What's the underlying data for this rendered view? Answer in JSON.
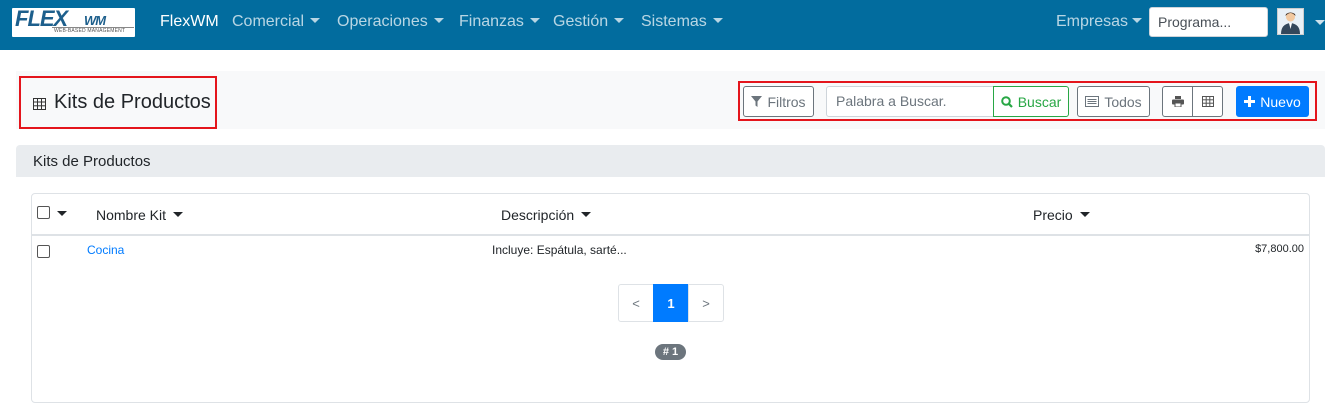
{
  "navbar": {
    "logo_text": "FLEX",
    "logo_suffix": "WM",
    "logo_tagline": "WEB-BASED MANAGEMENT",
    "brand": "FlexWM",
    "menus": [
      "Comercial",
      "Operaciones",
      "Finanzas",
      "Gestión",
      "Sistemas"
    ],
    "empresas": "Empresas",
    "program_placeholder": "Programa..."
  },
  "page": {
    "title": "Kits de Productos",
    "title_icon": "table-icon"
  },
  "toolbar": {
    "filters_label": "Filtros",
    "search_placeholder": "Palabra a Buscar.",
    "search_button": "Buscar",
    "all_label": "Todos",
    "print_icon": "print-icon",
    "grid_icon": "table-icon",
    "new_label": "Nuevo",
    "colors": {
      "primary": "#007bff",
      "success": "#28a745",
      "secondary": "#6c757d",
      "highlight": "#e4151c"
    }
  },
  "section": {
    "title": "Kits de Productos"
  },
  "table": {
    "columns": [
      "Nombre Kit",
      "Descripción",
      "Precio"
    ],
    "rows": [
      {
        "name": "Cocina",
        "description": "Incluye: Espátula, sarté...",
        "price": "$7,800.00"
      }
    ]
  },
  "pagination": {
    "prev": "<",
    "current": "1",
    "next": ">",
    "count": "# 1"
  },
  "theme": {
    "navbar_color": "#026c9e"
  }
}
